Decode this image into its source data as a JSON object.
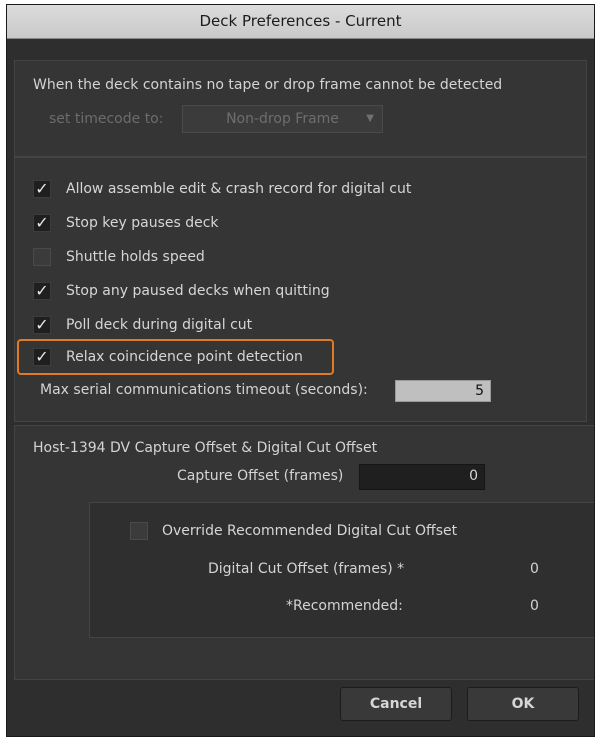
{
  "window": {
    "title": "Deck Preferences - Current"
  },
  "no_tape": {
    "description": "When the deck contains no tape or drop frame cannot be detected",
    "timecode_label": "set timecode to:",
    "timecode_value": "Non-drop Frame"
  },
  "options": [
    {
      "label": "Allow assemble edit & crash record for digital cut",
      "checked": true
    },
    {
      "label": "Stop key pauses deck",
      "checked": true
    },
    {
      "label": "Shuttle holds speed",
      "checked": false
    },
    {
      "label": "Stop any paused decks when quitting",
      "checked": true
    },
    {
      "label": "Poll deck during digital cut",
      "checked": true
    },
    {
      "label": "Relax coincidence point detection",
      "checked": true
    }
  ],
  "serial": {
    "label": "Max serial communications timeout (seconds):",
    "value": "5"
  },
  "offset": {
    "heading": "Host-1394 DV Capture Offset & Digital Cut Offset",
    "capture_label": "Capture Offset (frames)",
    "capture_value": "0",
    "override_label": "Override Recommended Digital Cut Offset",
    "override_checked": false,
    "digital_cut_label": "Digital Cut Offset (frames) *",
    "digital_cut_value": "0",
    "recommended_label": "*Recommended:",
    "recommended_value": "0"
  },
  "buttons": {
    "cancel": "Cancel",
    "ok": "OK"
  },
  "colors": {
    "highlight": "#e07b24",
    "dialog_bg": "#2e2e2e"
  }
}
